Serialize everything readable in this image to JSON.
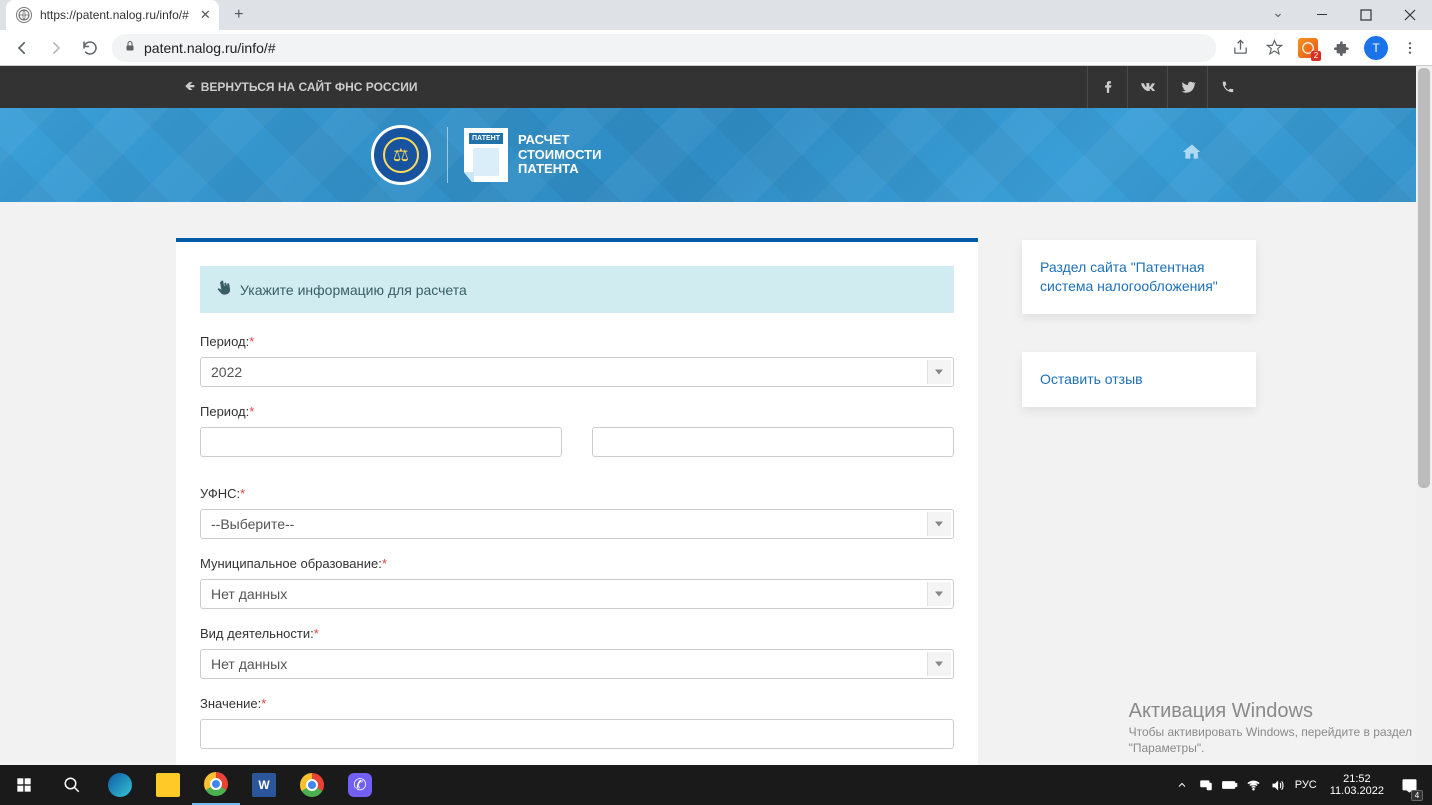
{
  "browser": {
    "tab_title": "https://patent.nalog.ru/info/#",
    "url": "patent.nalog.ru/info/#",
    "ext_badge": "2",
    "avatar_letter": "T"
  },
  "topbar": {
    "back_link": "ВЕРНУТЬСЯ НА САЙТ ФНС РОССИИ"
  },
  "banner": {
    "patent_label": "ПАТЕНТ",
    "title_line1": "РАСЧЕТ",
    "title_line2": "СТОИМОСТИ",
    "title_line3": "ПАТЕНТА"
  },
  "form": {
    "info_text": "Укажите информацию для расчета",
    "fields": {
      "period_year": {
        "label": "Период:",
        "value": "2022"
      },
      "period_range": {
        "label": "Период:"
      },
      "ufns": {
        "label": "УФНС:",
        "value": "--Выберите--"
      },
      "municipal": {
        "label": "Муниципальное образование:",
        "value": "Нет данных"
      },
      "activity": {
        "label": "Вид деятельности:",
        "value": "Нет данных"
      },
      "value": {
        "label": "Значение:"
      }
    }
  },
  "sidebar": {
    "link1": "Раздел сайта \"Патентная система налогообложения\"",
    "link2": "Оставить отзыв"
  },
  "watermark": {
    "title": "Активация Windows",
    "sub1": "Чтобы активировать Windows, перейдите в раздел",
    "sub2": "\"Параметры\"."
  },
  "taskbar": {
    "lang": "РУС",
    "time": "21:52",
    "date": "11.03.2022",
    "notif_count": "4"
  }
}
